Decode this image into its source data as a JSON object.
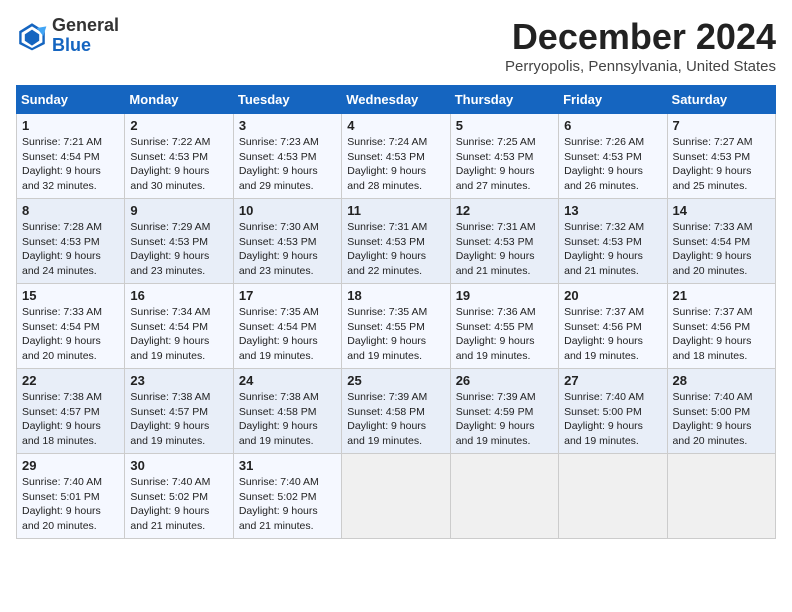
{
  "header": {
    "logo_line1": "General",
    "logo_line2": "Blue",
    "title": "December 2024",
    "location": "Perryopolis, Pennsylvania, United States"
  },
  "weekdays": [
    "Sunday",
    "Monday",
    "Tuesday",
    "Wednesday",
    "Thursday",
    "Friday",
    "Saturday"
  ],
  "weeks": [
    [
      {
        "day": "1",
        "sunrise": "Sunrise: 7:21 AM",
        "sunset": "Sunset: 4:54 PM",
        "daylight": "Daylight: 9 hours and 32 minutes."
      },
      {
        "day": "2",
        "sunrise": "Sunrise: 7:22 AM",
        "sunset": "Sunset: 4:53 PM",
        "daylight": "Daylight: 9 hours and 30 minutes."
      },
      {
        "day": "3",
        "sunrise": "Sunrise: 7:23 AM",
        "sunset": "Sunset: 4:53 PM",
        "daylight": "Daylight: 9 hours and 29 minutes."
      },
      {
        "day": "4",
        "sunrise": "Sunrise: 7:24 AM",
        "sunset": "Sunset: 4:53 PM",
        "daylight": "Daylight: 9 hours and 28 minutes."
      },
      {
        "day": "5",
        "sunrise": "Sunrise: 7:25 AM",
        "sunset": "Sunset: 4:53 PM",
        "daylight": "Daylight: 9 hours and 27 minutes."
      },
      {
        "day": "6",
        "sunrise": "Sunrise: 7:26 AM",
        "sunset": "Sunset: 4:53 PM",
        "daylight": "Daylight: 9 hours and 26 minutes."
      },
      {
        "day": "7",
        "sunrise": "Sunrise: 7:27 AM",
        "sunset": "Sunset: 4:53 PM",
        "daylight": "Daylight: 9 hours and 25 minutes."
      }
    ],
    [
      {
        "day": "8",
        "sunrise": "Sunrise: 7:28 AM",
        "sunset": "Sunset: 4:53 PM",
        "daylight": "Daylight: 9 hours and 24 minutes."
      },
      {
        "day": "9",
        "sunrise": "Sunrise: 7:29 AM",
        "sunset": "Sunset: 4:53 PM",
        "daylight": "Daylight: 9 hours and 23 minutes."
      },
      {
        "day": "10",
        "sunrise": "Sunrise: 7:30 AM",
        "sunset": "Sunset: 4:53 PM",
        "daylight": "Daylight: 9 hours and 23 minutes."
      },
      {
        "day": "11",
        "sunrise": "Sunrise: 7:31 AM",
        "sunset": "Sunset: 4:53 PM",
        "daylight": "Daylight: 9 hours and 22 minutes."
      },
      {
        "day": "12",
        "sunrise": "Sunrise: 7:31 AM",
        "sunset": "Sunset: 4:53 PM",
        "daylight": "Daylight: 9 hours and 21 minutes."
      },
      {
        "day": "13",
        "sunrise": "Sunrise: 7:32 AM",
        "sunset": "Sunset: 4:53 PM",
        "daylight": "Daylight: 9 hours and 21 minutes."
      },
      {
        "day": "14",
        "sunrise": "Sunrise: 7:33 AM",
        "sunset": "Sunset: 4:54 PM",
        "daylight": "Daylight: 9 hours and 20 minutes."
      }
    ],
    [
      {
        "day": "15",
        "sunrise": "Sunrise: 7:33 AM",
        "sunset": "Sunset: 4:54 PM",
        "daylight": "Daylight: 9 hours and 20 minutes."
      },
      {
        "day": "16",
        "sunrise": "Sunrise: 7:34 AM",
        "sunset": "Sunset: 4:54 PM",
        "daylight": "Daylight: 9 hours and 19 minutes."
      },
      {
        "day": "17",
        "sunrise": "Sunrise: 7:35 AM",
        "sunset": "Sunset: 4:54 PM",
        "daylight": "Daylight: 9 hours and 19 minutes."
      },
      {
        "day": "18",
        "sunrise": "Sunrise: 7:35 AM",
        "sunset": "Sunset: 4:55 PM",
        "daylight": "Daylight: 9 hours and 19 minutes."
      },
      {
        "day": "19",
        "sunrise": "Sunrise: 7:36 AM",
        "sunset": "Sunset: 4:55 PM",
        "daylight": "Daylight: 9 hours and 19 minutes."
      },
      {
        "day": "20",
        "sunrise": "Sunrise: 7:37 AM",
        "sunset": "Sunset: 4:56 PM",
        "daylight": "Daylight: 9 hours and 19 minutes."
      },
      {
        "day": "21",
        "sunrise": "Sunrise: 7:37 AM",
        "sunset": "Sunset: 4:56 PM",
        "daylight": "Daylight: 9 hours and 18 minutes."
      }
    ],
    [
      {
        "day": "22",
        "sunrise": "Sunrise: 7:38 AM",
        "sunset": "Sunset: 4:57 PM",
        "daylight": "Daylight: 9 hours and 18 minutes."
      },
      {
        "day": "23",
        "sunrise": "Sunrise: 7:38 AM",
        "sunset": "Sunset: 4:57 PM",
        "daylight": "Daylight: 9 hours and 19 minutes."
      },
      {
        "day": "24",
        "sunrise": "Sunrise: 7:38 AM",
        "sunset": "Sunset: 4:58 PM",
        "daylight": "Daylight: 9 hours and 19 minutes."
      },
      {
        "day": "25",
        "sunrise": "Sunrise: 7:39 AM",
        "sunset": "Sunset: 4:58 PM",
        "daylight": "Daylight: 9 hours and 19 minutes."
      },
      {
        "day": "26",
        "sunrise": "Sunrise: 7:39 AM",
        "sunset": "Sunset: 4:59 PM",
        "daylight": "Daylight: 9 hours and 19 minutes."
      },
      {
        "day": "27",
        "sunrise": "Sunrise: 7:40 AM",
        "sunset": "Sunset: 5:00 PM",
        "daylight": "Daylight: 9 hours and 19 minutes."
      },
      {
        "day": "28",
        "sunrise": "Sunrise: 7:40 AM",
        "sunset": "Sunset: 5:00 PM",
        "daylight": "Daylight: 9 hours and 20 minutes."
      }
    ],
    [
      {
        "day": "29",
        "sunrise": "Sunrise: 7:40 AM",
        "sunset": "Sunset: 5:01 PM",
        "daylight": "Daylight: 9 hours and 20 minutes."
      },
      {
        "day": "30",
        "sunrise": "Sunrise: 7:40 AM",
        "sunset": "Sunset: 5:02 PM",
        "daylight": "Daylight: 9 hours and 21 minutes."
      },
      {
        "day": "31",
        "sunrise": "Sunrise: 7:40 AM",
        "sunset": "Sunset: 5:02 PM",
        "daylight": "Daylight: 9 hours and 21 minutes."
      },
      null,
      null,
      null,
      null
    ]
  ]
}
